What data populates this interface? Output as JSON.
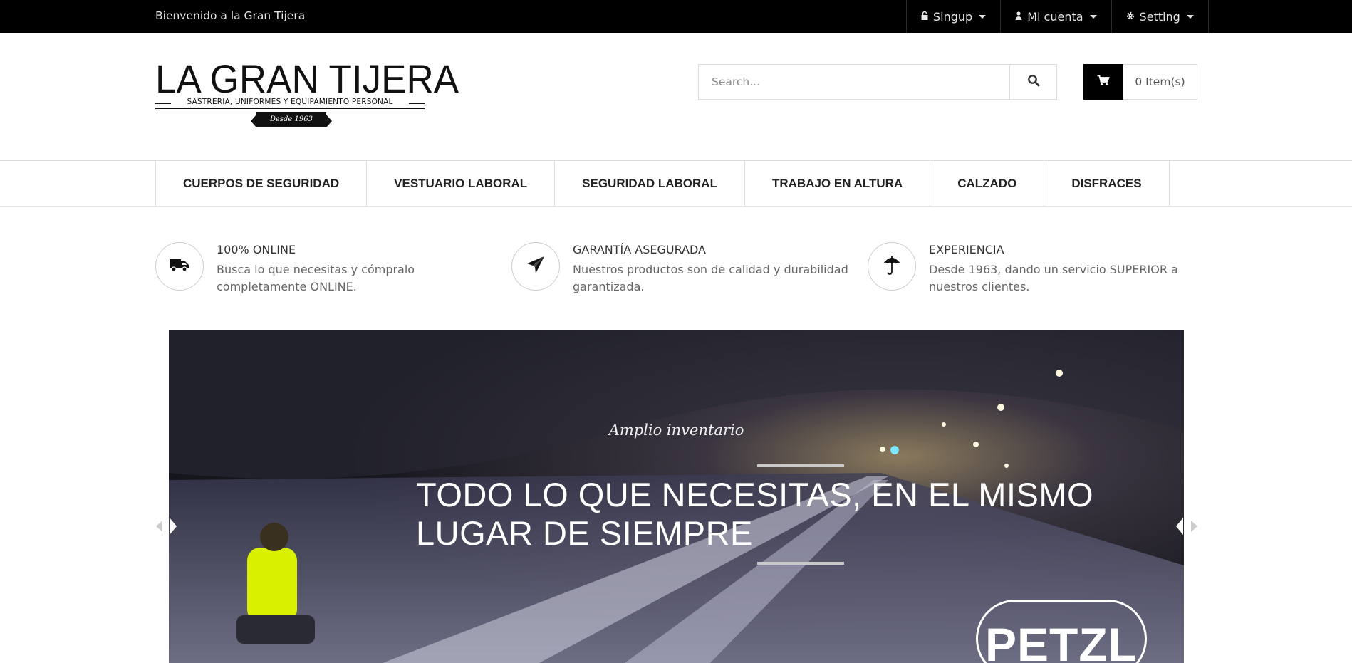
{
  "topbar": {
    "welcome": "Bienvenido a la Gran Tijera",
    "menus": [
      {
        "label": "Singup",
        "icon": "lock-icon"
      },
      {
        "label": "Mi cuenta",
        "icon": "user-icon"
      },
      {
        "label": "Setting",
        "icon": "gear-icon"
      }
    ]
  },
  "logo": {
    "title": "LA GRAN TIJERA",
    "subtitle": "SASTRERIA, UNIFORMES Y EQUIPAMIENTO PERSONAL",
    "since": "Desde 1963"
  },
  "search": {
    "placeholder": "Search...",
    "icon": "search-icon"
  },
  "cart": {
    "label": "0 Item(s)",
    "icon": "cart-icon"
  },
  "nav": {
    "items": [
      {
        "label": "CUERPOS DE SEGURIDAD"
      },
      {
        "label": "VESTUARIO LABORAL"
      },
      {
        "label": "SEGURIDAD LABORAL"
      },
      {
        "label": "TRABAJO EN ALTURA"
      },
      {
        "label": "CALZADO"
      },
      {
        "label": "DISFRACES"
      }
    ]
  },
  "features": [
    {
      "icon": "truck-icon",
      "title": "100% ONLINE",
      "desc": "Busca lo que necesitas y cómpralo completamente ONLINE."
    },
    {
      "icon": "paper-plane-icon",
      "title": "GARANTÍA ASEGURADA",
      "desc": "Nuestros productos son de calidad y durabilidad garantizada."
    },
    {
      "icon": "umbrella-icon",
      "title": "EXPERIENCIA",
      "desc": "Desde 1963, dando un servicio SUPERIOR a nuestros clientes."
    }
  ],
  "slider": {
    "subtitle": "Amplio inventario",
    "headline": "TODO LO QUE NECESITAS, EN EL MISMO LUGAR DE SIEMPRE",
    "brand": "PETZL"
  },
  "colors": {
    "topbar": "#000000",
    "accent": "#000000",
    "text": "#333333"
  }
}
